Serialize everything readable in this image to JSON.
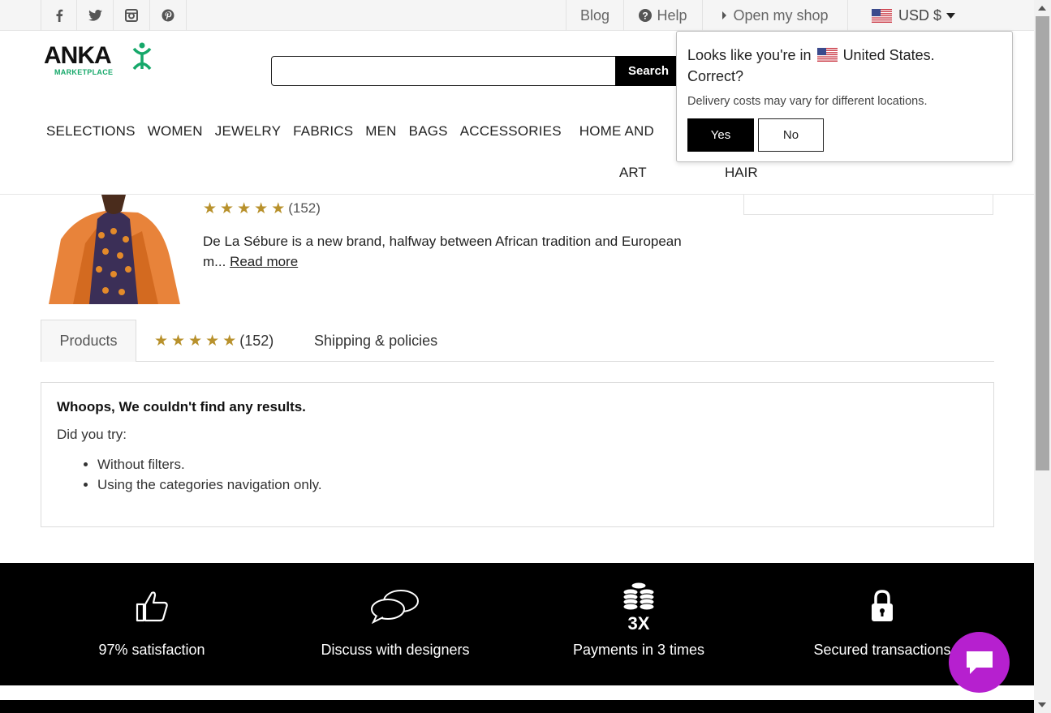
{
  "topbar": {
    "social": [
      "facebook-icon",
      "twitter-icon",
      "instagram-icon",
      "pinterest-icon"
    ],
    "blog": "Blog",
    "help": "Help",
    "open_shop": "Open my shop",
    "currency": "USD $"
  },
  "header": {
    "logo_word": "ANKA",
    "logo_sub": "MARKETPLACE",
    "search_placeholder": "",
    "search_button": "Search"
  },
  "nav": {
    "items": [
      "SELECTIONS",
      "WOMEN",
      "JEWELRY",
      "FABRICS",
      "MEN",
      "BAGS",
      "ACCESSORIES",
      "HOME AND"
    ],
    "row2": [
      "ART",
      "HAIR"
    ]
  },
  "shop": {
    "review_count": "(152)",
    "description": "De La Sébure is a new brand, halfway between African tradition and European m...",
    "read_more": "Read more",
    "rating_stars": 5
  },
  "tabs": {
    "products": "Products",
    "reviews_count": "(152)",
    "shipping": "Shipping & policies"
  },
  "results": {
    "title": "Whoops, We couldn't find any results.",
    "prompt": "Did you try:",
    "suggestions": [
      "Without filters.",
      "Using the categories navigation only."
    ]
  },
  "features": [
    {
      "icon": "thumbs-up-icon",
      "label": "97% satisfaction"
    },
    {
      "icon": "speech-bubbles-icon",
      "label": "Discuss with designers"
    },
    {
      "icon": "coins-3x-icon",
      "label": "Payments in 3 times"
    },
    {
      "icon": "padlock-icon",
      "label": "Secured transactions"
    }
  ],
  "popup": {
    "line1_pre": "Looks like you're in",
    "country": "United States.",
    "line2": "Correct?",
    "note": "Delivery costs may vary for different locations.",
    "yes": "Yes",
    "no": "No"
  },
  "colors": {
    "accent_green": "#16a86a",
    "star_gold": "#b8912c",
    "chat_purple": "#b620cf"
  }
}
